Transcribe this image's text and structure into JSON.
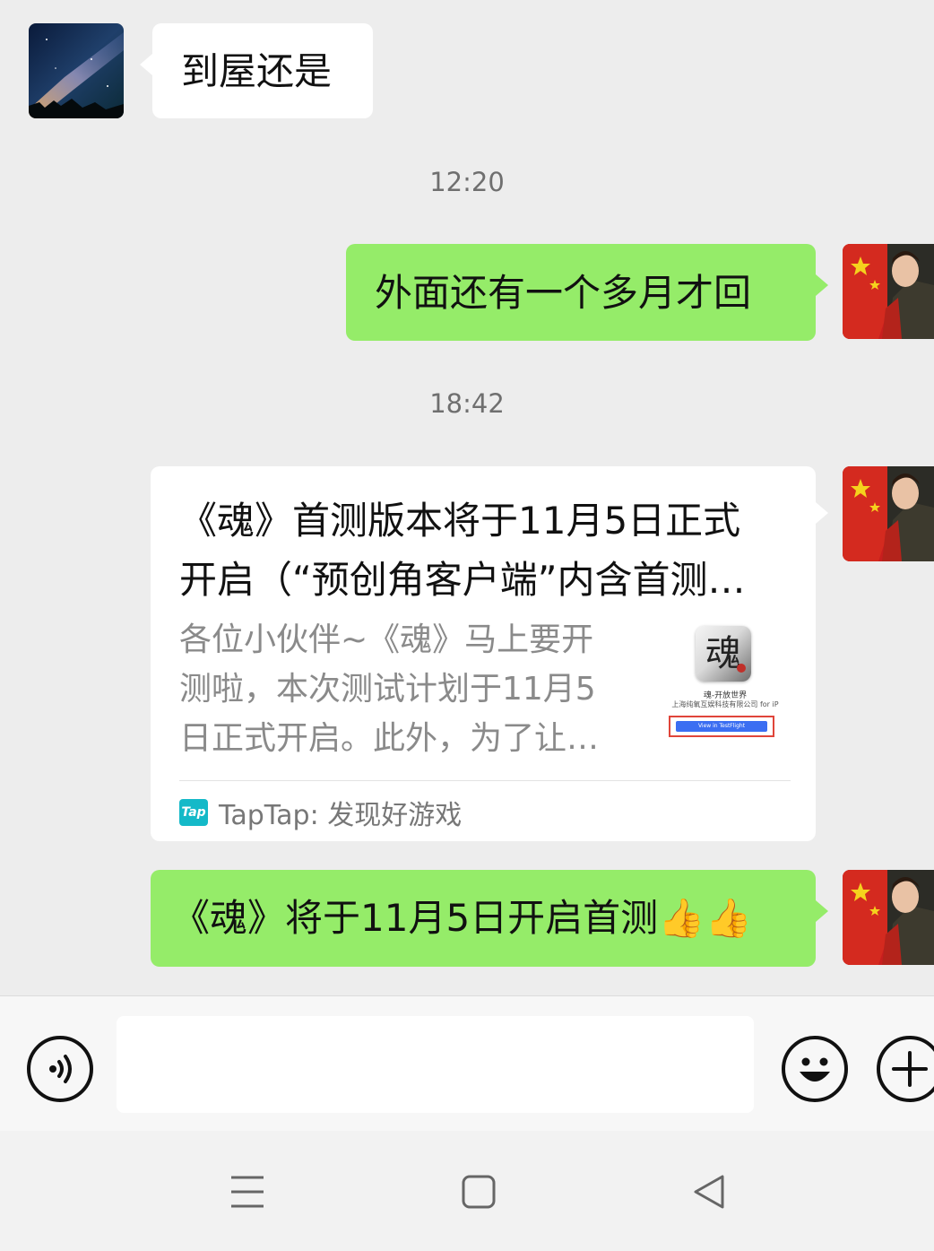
{
  "messages": [
    {
      "side": "left",
      "text": "到屋还是"
    },
    {
      "side": "right",
      "text": "外面还有一个多月才回"
    },
    {
      "side": "right",
      "text": "《魂》将于11月5日开启首测👍👍"
    }
  ],
  "timestamps": [
    "12:20",
    "18:42"
  ],
  "link_card": {
    "title_line1": "《魂》首测版本将于11月5日正式",
    "title_line2": "开启（“预创角客户端”内含首测…",
    "desc_line1": "各位小伙伴~《魂》马上要开",
    "desc_line2": "测啦，本次测试计划于11月5",
    "desc_line3": "日正式开启。此外，为了让…",
    "source_logo": "Tap",
    "source": "TapTap: 发现好游戏",
    "thumb_glyph": "魂",
    "thumb_appname": "魂-开放世界",
    "thumb_company": "上海纯氧互娱科技有限公司 for iP",
    "thumb_button": "View in TestFlight"
  },
  "input": {
    "value": ""
  },
  "icons": {
    "voice": "voice-icon",
    "emoji": "emoji-icon",
    "plus": "plus-icon",
    "nav_menu": "menu-icon",
    "nav_home": "home-icon",
    "nav_back": "back-icon"
  },
  "colors": {
    "background": "#ededed",
    "sent_bubble": "#95ec69",
    "received_bubble": "#ffffff",
    "timestamp": "#6f6f6f",
    "tap_logo": "#14b9c8"
  }
}
